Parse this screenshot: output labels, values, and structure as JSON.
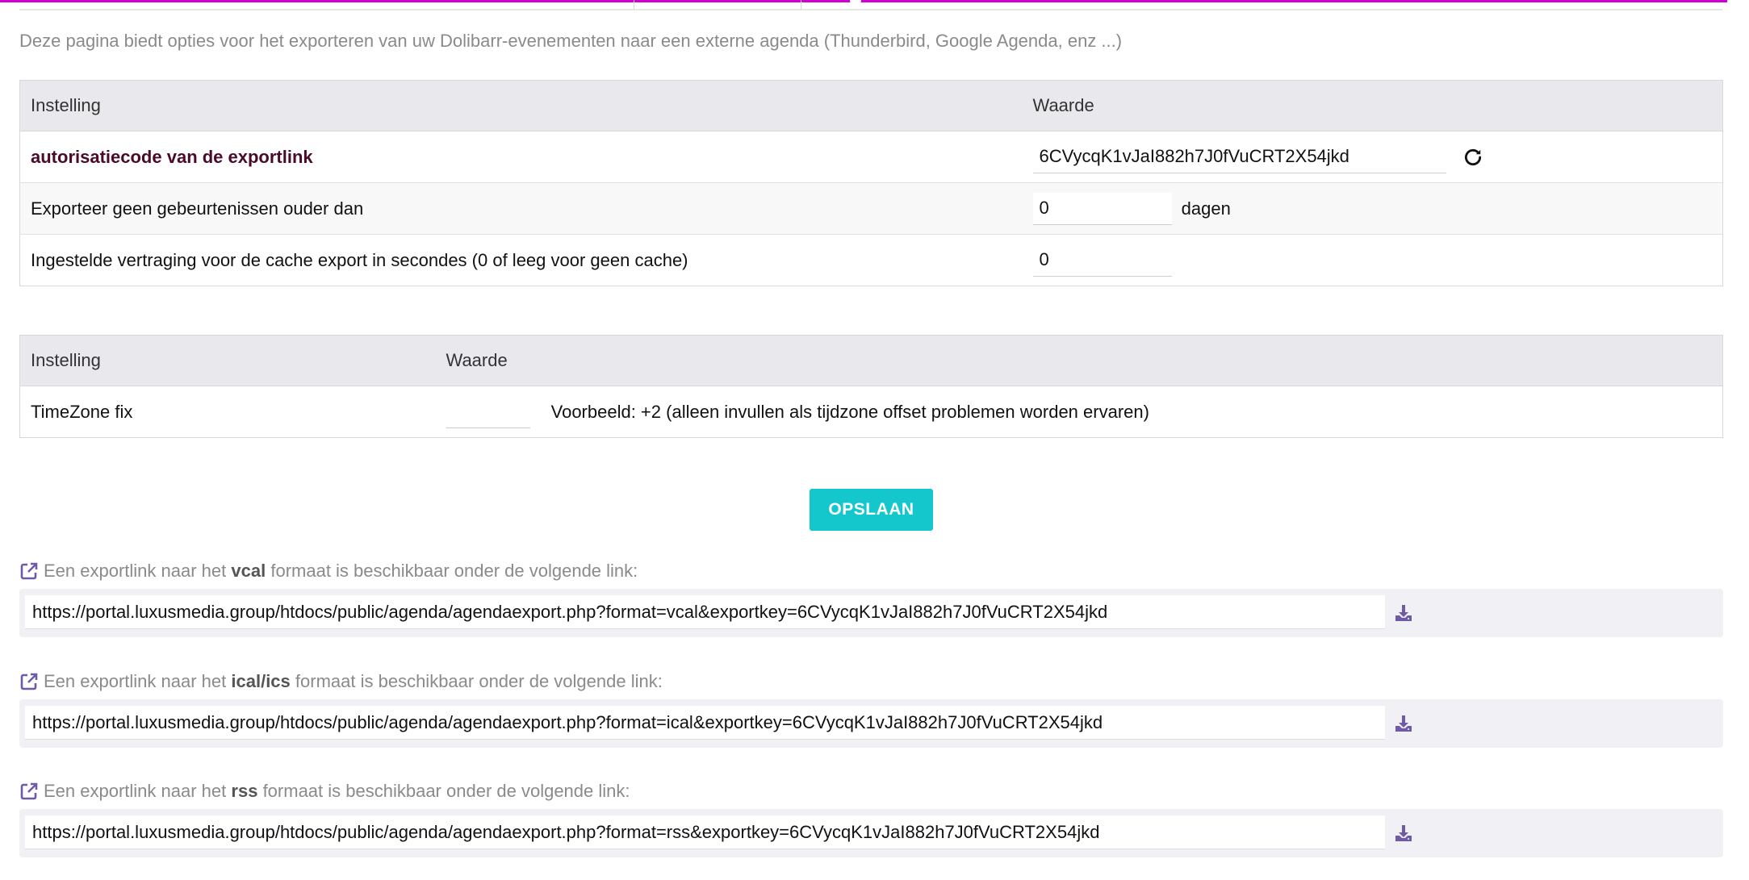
{
  "intro": "Deze pagina biedt opties voor het exporteren van uw Dolibarr-evenementen naar een externe agenda (Thunderbird, Google Agenda, enz ...)",
  "table1": {
    "col_setting": "Instelling",
    "col_value": "Waarde",
    "rows": [
      {
        "label": "autorisatiecode van de exportlink",
        "value": "6CVycqK1vJaI882h7J0fVuCRT2X54jkd"
      },
      {
        "label": "Exporteer geen gebeurtenissen ouder dan",
        "value": "0",
        "unit": "dagen"
      },
      {
        "label": "Ingestelde vertraging voor de cache export in secondes (0 of leeg voor geen cache)",
        "value": "0"
      }
    ]
  },
  "table2": {
    "col_setting": "Instelling",
    "col_value": "Waarde",
    "rows": [
      {
        "label": "TimeZone fix",
        "value": "",
        "hint": "Voorbeeld: +2 (alleen invullen als tijdzone offset problemen worden ervaren)"
      }
    ]
  },
  "save_label": "OPSLAAN",
  "exports": [
    {
      "prefix": "Een exportlink naar het",
      "format": "vcal",
      "suffix": "formaat is beschikbaar onder de volgende link:",
      "url": "https://portal.luxusmedia.group/htdocs/public/agenda/agendaexport.php?format=vcal&exportkey=6CVycqK1vJaI882h7J0fVuCRT2X54jkd"
    },
    {
      "prefix": "Een exportlink naar het",
      "format": "ical/ics",
      "suffix": "formaat is beschikbaar onder de volgende link:",
      "url": "https://portal.luxusmedia.group/htdocs/public/agenda/agendaexport.php?format=ical&exportkey=6CVycqK1vJaI882h7J0fVuCRT2X54jkd"
    },
    {
      "prefix": "Een exportlink naar het",
      "format": "rss",
      "suffix": "formaat is beschikbaar onder de volgende link:",
      "url": "https://portal.luxusmedia.group/htdocs/public/agenda/agendaexport.php?format=rss&exportkey=6CVycqK1vJaI882h7J0fVuCRT2X54jkd"
    }
  ],
  "icons": {
    "refresh": "refresh-icon",
    "external_link": "external-link-icon",
    "download": "download-icon"
  },
  "colors": {
    "accent_tab": "#d300d3",
    "save_button": "#14c7cc",
    "icon_purple": "#6e5aa8",
    "label_dark": "#4a0a2a"
  }
}
